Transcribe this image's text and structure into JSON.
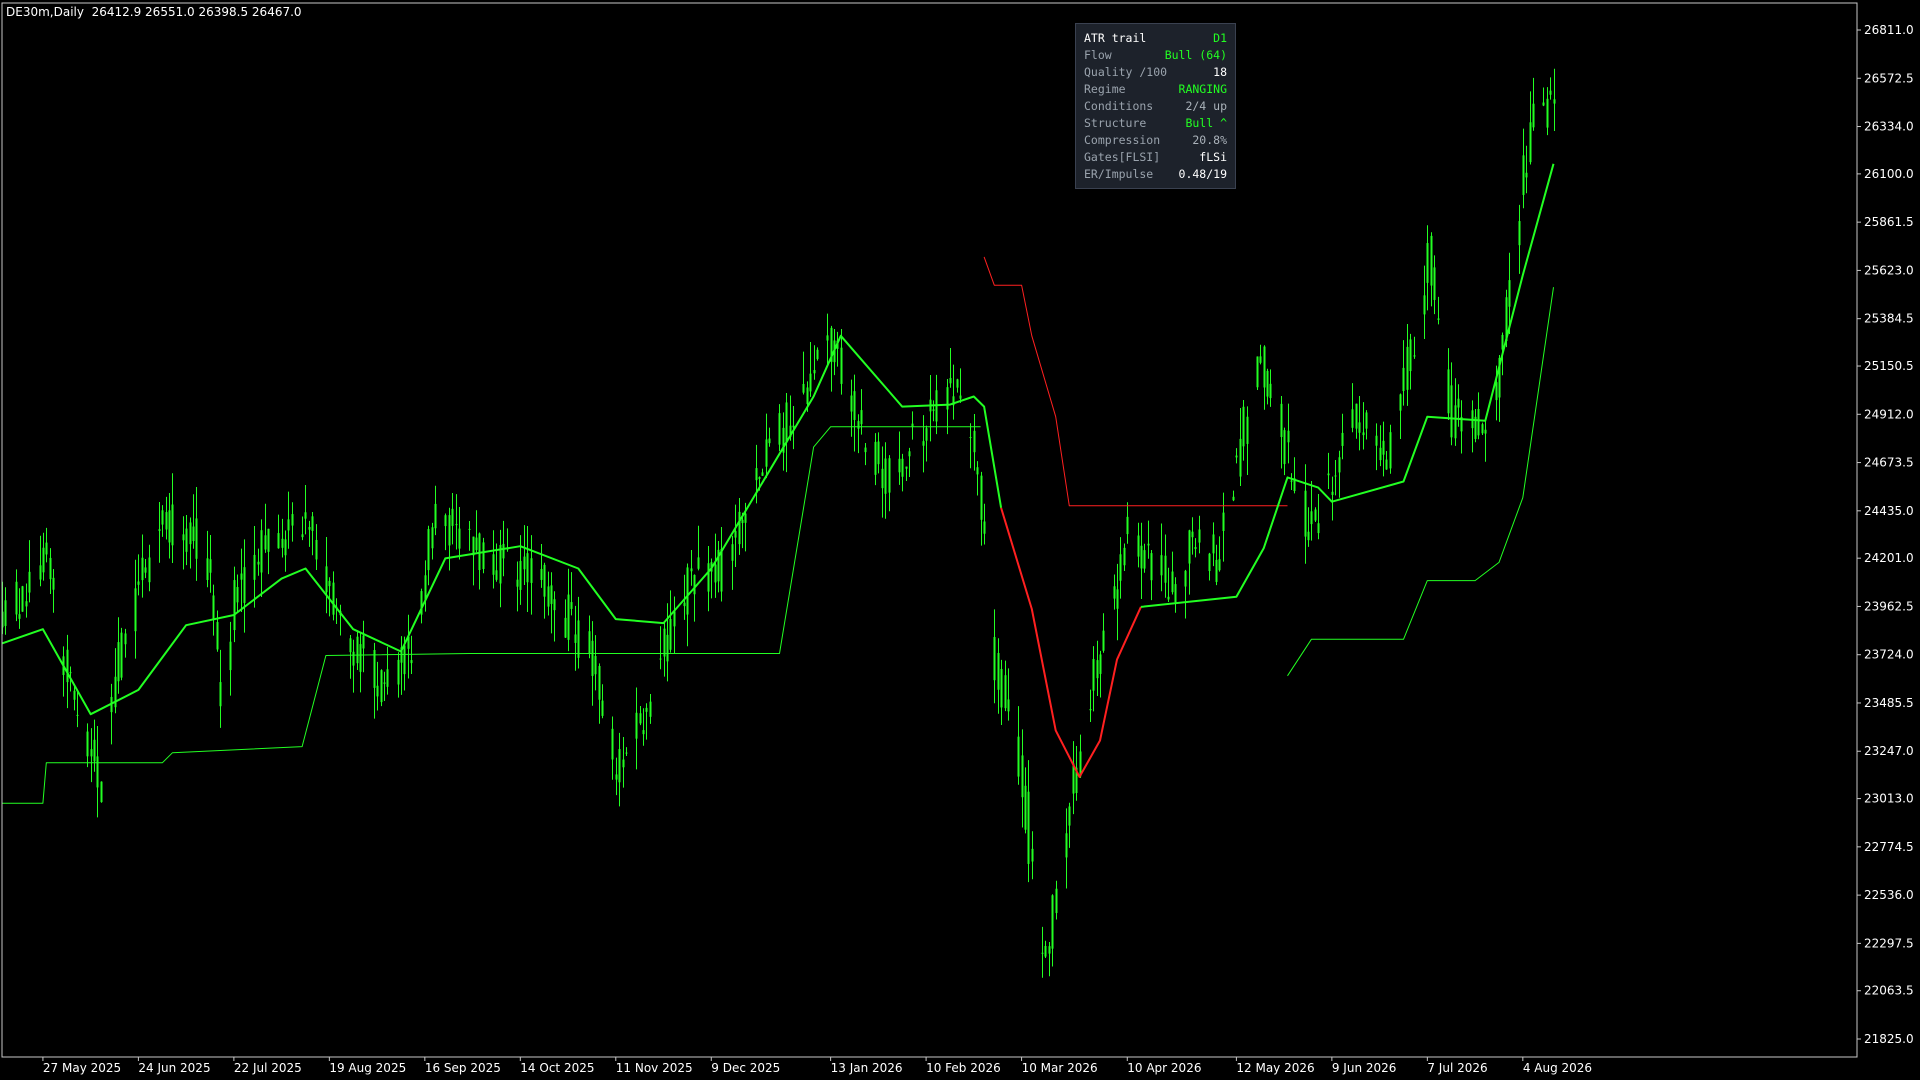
{
  "header": {
    "symbol_tf": "DE30m,Daily",
    "ohlc": "26412.9 26551.0 26398.5 26467.0"
  },
  "price_axis": {
    "ticks": [
      "26811.0",
      "26572.5",
      "26334.0",
      "26100.0",
      "25861.5",
      "25623.0",
      "25384.5",
      "25150.5",
      "24912.0",
      "24673.5",
      "24435.0",
      "24201.0",
      "23962.5",
      "23724.0",
      "23485.5",
      "23247.0",
      "23013.0",
      "22774.5",
      "22536.0",
      "22297.5",
      "22063.5",
      "21825.0"
    ]
  },
  "time_axis": {
    "ticks": [
      "27 May 2025",
      "24 Jun 2025",
      "22 Jul 2025",
      "19 Aug 2025",
      "16 Sep 2025",
      "14 Oct 2025",
      "11 Nov 2025",
      "9 Dec 2025",
      "13 Jan 2026",
      "10 Feb 2026",
      "10 Mar 2026",
      "10 Apr 2026",
      "12 May 2026",
      "9 Jun 2026",
      "7 Jul 2026",
      "4 Aug 2026"
    ]
  },
  "colors": {
    "bull": "#22ff22",
    "bear": "#ff2020",
    "background": "#000000",
    "panel_bg": "#1d222b",
    "text": "#ffffff",
    "label": "#9aa3ad",
    "value_gray": "#aab2ba"
  },
  "panel": {
    "title": "ATR trail",
    "title_value": "D1",
    "rows": [
      {
        "key": "Flow",
        "value": "Bull (64)",
        "color": "#22ff22"
      },
      {
        "key": "Quality /100",
        "value": "18",
        "color": "#ffffff"
      },
      {
        "key": "Regime",
        "value": "RANGING",
        "color": "#22ff22"
      },
      {
        "key": "Conditions",
        "value": "2/4 up",
        "color": "#aab2ba"
      },
      {
        "key": "Structure",
        "value": "Bull ^",
        "color": "#22ff22"
      },
      {
        "key": "Compression",
        "value": "20.8%",
        "color": "#aab2ba"
      },
      {
        "key": "Gates[FLSI]",
        "value": "fLSi",
        "color": "#ffffff"
      },
      {
        "key": "ER/Impulse",
        "value": "0.48/19",
        "color": "#ffffff"
      }
    ]
  },
  "chart_data": {
    "type": "candlestick",
    "ylim": [
      21825.0,
      26811.0
    ],
    "close_path": [
      [
        "2025-05-15",
        23900
      ],
      [
        "2025-05-27",
        24200
      ],
      [
        "2025-06-05",
        23500
      ],
      [
        "2025-06-12",
        23100
      ],
      [
        "2025-06-18",
        23700
      ],
      [
        "2025-06-24",
        24050
      ],
      [
        "2025-07-01",
        24400
      ],
      [
        "2025-07-10",
        24300
      ],
      [
        "2025-07-15",
        24050
      ],
      [
        "2025-07-18",
        23500
      ],
      [
        "2025-07-22",
        24000
      ],
      [
        "2025-08-01",
        24300
      ],
      [
        "2025-08-12",
        24350
      ],
      [
        "2025-08-19",
        24050
      ],
      [
        "2025-08-26",
        23750
      ],
      [
        "2025-09-05",
        23550
      ],
      [
        "2025-09-12",
        23800
      ],
      [
        "2025-09-18",
        24400
      ],
      [
        "2025-09-25",
        24350
      ],
      [
        "2025-10-03",
        24200
      ],
      [
        "2025-10-14",
        24150
      ],
      [
        "2025-10-24",
        24000
      ],
      [
        "2025-11-04",
        23700
      ],
      [
        "2025-11-11",
        23150
      ],
      [
        "2025-11-18",
        23400
      ],
      [
        "2025-11-26",
        23800
      ],
      [
        "2025-12-03",
        24100
      ],
      [
        "2025-12-12",
        24150
      ],
      [
        "2025-12-22",
        24600
      ],
      [
        "2026-01-05",
        25050
      ],
      [
        "2026-01-13",
        25300
      ],
      [
        "2026-01-20",
        24900
      ],
      [
        "2026-01-28",
        24600
      ],
      [
        "2026-02-03",
        24700
      ],
      [
        "2026-02-10",
        24900
      ],
      [
        "2026-02-18",
        25000
      ],
      [
        "2026-02-24",
        24750
      ],
      [
        "2026-03-02",
        23700
      ],
      [
        "2026-03-06",
        23400
      ],
      [
        "2026-03-10",
        23100
      ],
      [
        "2026-03-16",
        22200
      ],
      [
        "2026-03-20",
        22550
      ],
      [
        "2026-03-26",
        23200
      ],
      [
        "2026-04-02",
        23800
      ],
      [
        "2026-04-10",
        24300
      ],
      [
        "2026-04-17",
        24150
      ],
      [
        "2026-04-24",
        24050
      ],
      [
        "2026-04-30",
        24350
      ],
      [
        "2026-05-06",
        24150
      ],
      [
        "2026-05-12",
        24700
      ],
      [
        "2026-05-18",
        25200
      ],
      [
        "2026-05-25",
        24800
      ],
      [
        "2026-06-02",
        24300
      ],
      [
        "2026-06-09",
        24600
      ],
      [
        "2026-06-16",
        24900
      ],
      [
        "2026-06-25",
        24700
      ],
      [
        "2026-07-03",
        25300
      ],
      [
        "2026-07-07",
        25700
      ],
      [
        "2026-07-14",
        24900
      ],
      [
        "2026-07-24",
        24800
      ],
      [
        "2026-07-29",
        25300
      ],
      [
        "2026-08-04",
        26100
      ],
      [
        "2026-08-07",
        26350
      ],
      [
        "2026-08-13",
        26467
      ]
    ],
    "fast_line": [
      [
        "2025-05-15",
        23780,
        "bull"
      ],
      [
        "2025-05-27",
        23850,
        "bull"
      ],
      [
        "2025-06-10",
        23430,
        "bull"
      ],
      [
        "2025-06-24",
        23550,
        "bull"
      ],
      [
        "2025-07-08",
        23870,
        "bull"
      ],
      [
        "2025-07-22",
        23920,
        "bull"
      ],
      [
        "2025-08-05",
        24100,
        "bull"
      ],
      [
        "2025-08-12",
        24150,
        "bull"
      ],
      [
        "2025-08-26",
        23850,
        "bull"
      ],
      [
        "2025-09-09",
        23740,
        "bull"
      ],
      [
        "2025-09-22",
        24200,
        "bull"
      ],
      [
        "2025-10-14",
        24260,
        "bull"
      ],
      [
        "2025-10-31",
        24150,
        "bull"
      ],
      [
        "2025-11-11",
        23900,
        "bull"
      ],
      [
        "2025-11-25",
        23880,
        "bull"
      ],
      [
        "2025-12-09",
        24150,
        "bull"
      ],
      [
        "2026-01-08",
        25000,
        "bull"
      ],
      [
        "2026-01-16",
        25300,
        "bull"
      ],
      [
        "2026-02-03",
        24950,
        "bull"
      ],
      [
        "2026-02-17",
        24960,
        "bull"
      ],
      [
        "2026-02-24",
        25000,
        "bull"
      ],
      [
        "2026-02-27",
        24950,
        "bull"
      ],
      [
        "2026-03-04",
        24450,
        "bear"
      ],
      [
        "2026-03-13",
        23950,
        "bear"
      ],
      [
        "2026-03-20",
        23350,
        "bear"
      ],
      [
        "2026-03-27",
        23120,
        "bear"
      ],
      [
        "2026-04-02",
        23300,
        "bear"
      ],
      [
        "2026-04-07",
        23700,
        "bear"
      ],
      [
        "2026-04-14",
        23960,
        "bull"
      ],
      [
        "2026-05-12",
        24010,
        "bull"
      ],
      [
        "2026-05-20",
        24250,
        "bull"
      ],
      [
        "2026-05-27",
        24600,
        "bull"
      ],
      [
        "2026-06-05",
        24550,
        "bull"
      ],
      [
        "2026-06-09",
        24480,
        "bull"
      ],
      [
        "2026-06-30",
        24580,
        "bull"
      ],
      [
        "2026-07-07",
        24900,
        "bull"
      ],
      [
        "2026-07-24",
        24880,
        "bull"
      ],
      [
        "2026-08-04",
        25600,
        "bull"
      ],
      [
        "2026-08-13",
        26150,
        "bull"
      ]
    ],
    "trail_bull_1": [
      [
        "2025-05-15",
        22990
      ],
      [
        "2025-05-27",
        22990
      ],
      [
        "2025-05-28",
        23190
      ],
      [
        "2025-07-01",
        23190
      ],
      [
        "2025-07-04",
        23240
      ],
      [
        "2025-08-11",
        23270
      ],
      [
        "2025-08-18",
        23720
      ],
      [
        "2025-09-29",
        23730
      ],
      [
        "2025-12-29",
        23730
      ],
      [
        "2026-01-08",
        24750
      ],
      [
        "2026-01-13",
        24850
      ],
      [
        "2026-02-26",
        24850
      ]
    ],
    "trail_bear": [
      [
        "2026-02-27",
        25690
      ],
      [
        "2026-03-02",
        25550
      ],
      [
        "2026-03-10",
        25550
      ],
      [
        "2026-03-13",
        25300
      ],
      [
        "2026-03-20",
        24900
      ],
      [
        "2026-03-24",
        24460
      ],
      [
        "2026-05-27",
        24460
      ]
    ],
    "trail_bull_2": [
      [
        "2026-05-27",
        23620
      ],
      [
        "2026-06-03",
        23800
      ],
      [
        "2026-06-30",
        23800
      ],
      [
        "2026-07-07",
        24090
      ],
      [
        "2026-07-21",
        24090
      ],
      [
        "2026-07-28",
        24180
      ],
      [
        "2026-08-04",
        24500
      ],
      [
        "2026-08-13",
        25540
      ]
    ],
    "x_range": [
      "2025-05-15",
      "2026-11-10"
    ]
  }
}
